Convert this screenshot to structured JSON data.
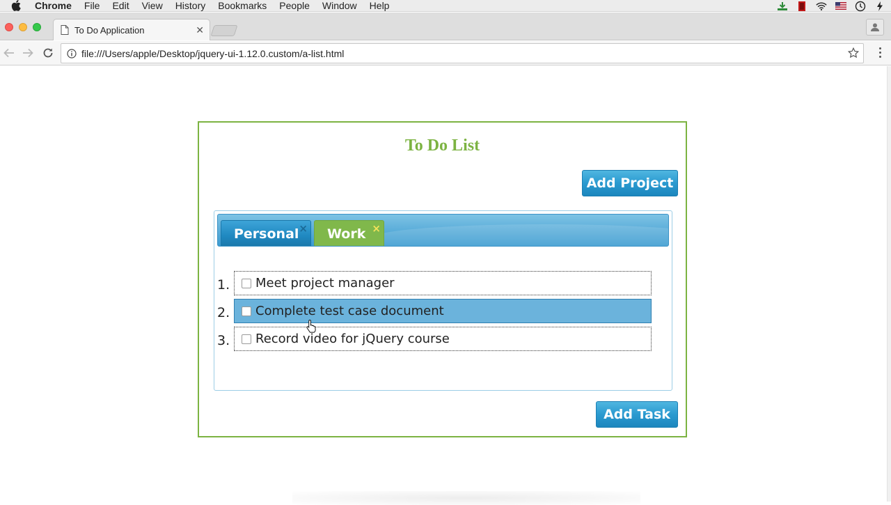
{
  "menubar": {
    "items": [
      "Chrome",
      "File",
      "Edit",
      "View",
      "History",
      "Bookmarks",
      "People",
      "Window",
      "Help"
    ]
  },
  "browser": {
    "tab_title": "To Do Application",
    "url": "file:///Users/apple/Desktop/jquery-ui-1.12.0.custom/a-list.html"
  },
  "app": {
    "title": "To Do List",
    "add_project_label": "Add Project",
    "add_task_label": "Add Task",
    "tabs": [
      {
        "label": "Personal",
        "close": "×"
      },
      {
        "label": "Work",
        "close": "×"
      }
    ],
    "tasks": [
      {
        "num": "1.",
        "text": "Meet project manager"
      },
      {
        "num": "2.",
        "text": "Complete test case document"
      },
      {
        "num": "3.",
        "text": "Record video for jQuery course"
      }
    ]
  },
  "colors": {
    "accent_green": "#7cb342",
    "button_blue": "#2a9ad0",
    "selected_row": "#6bb3dc"
  }
}
